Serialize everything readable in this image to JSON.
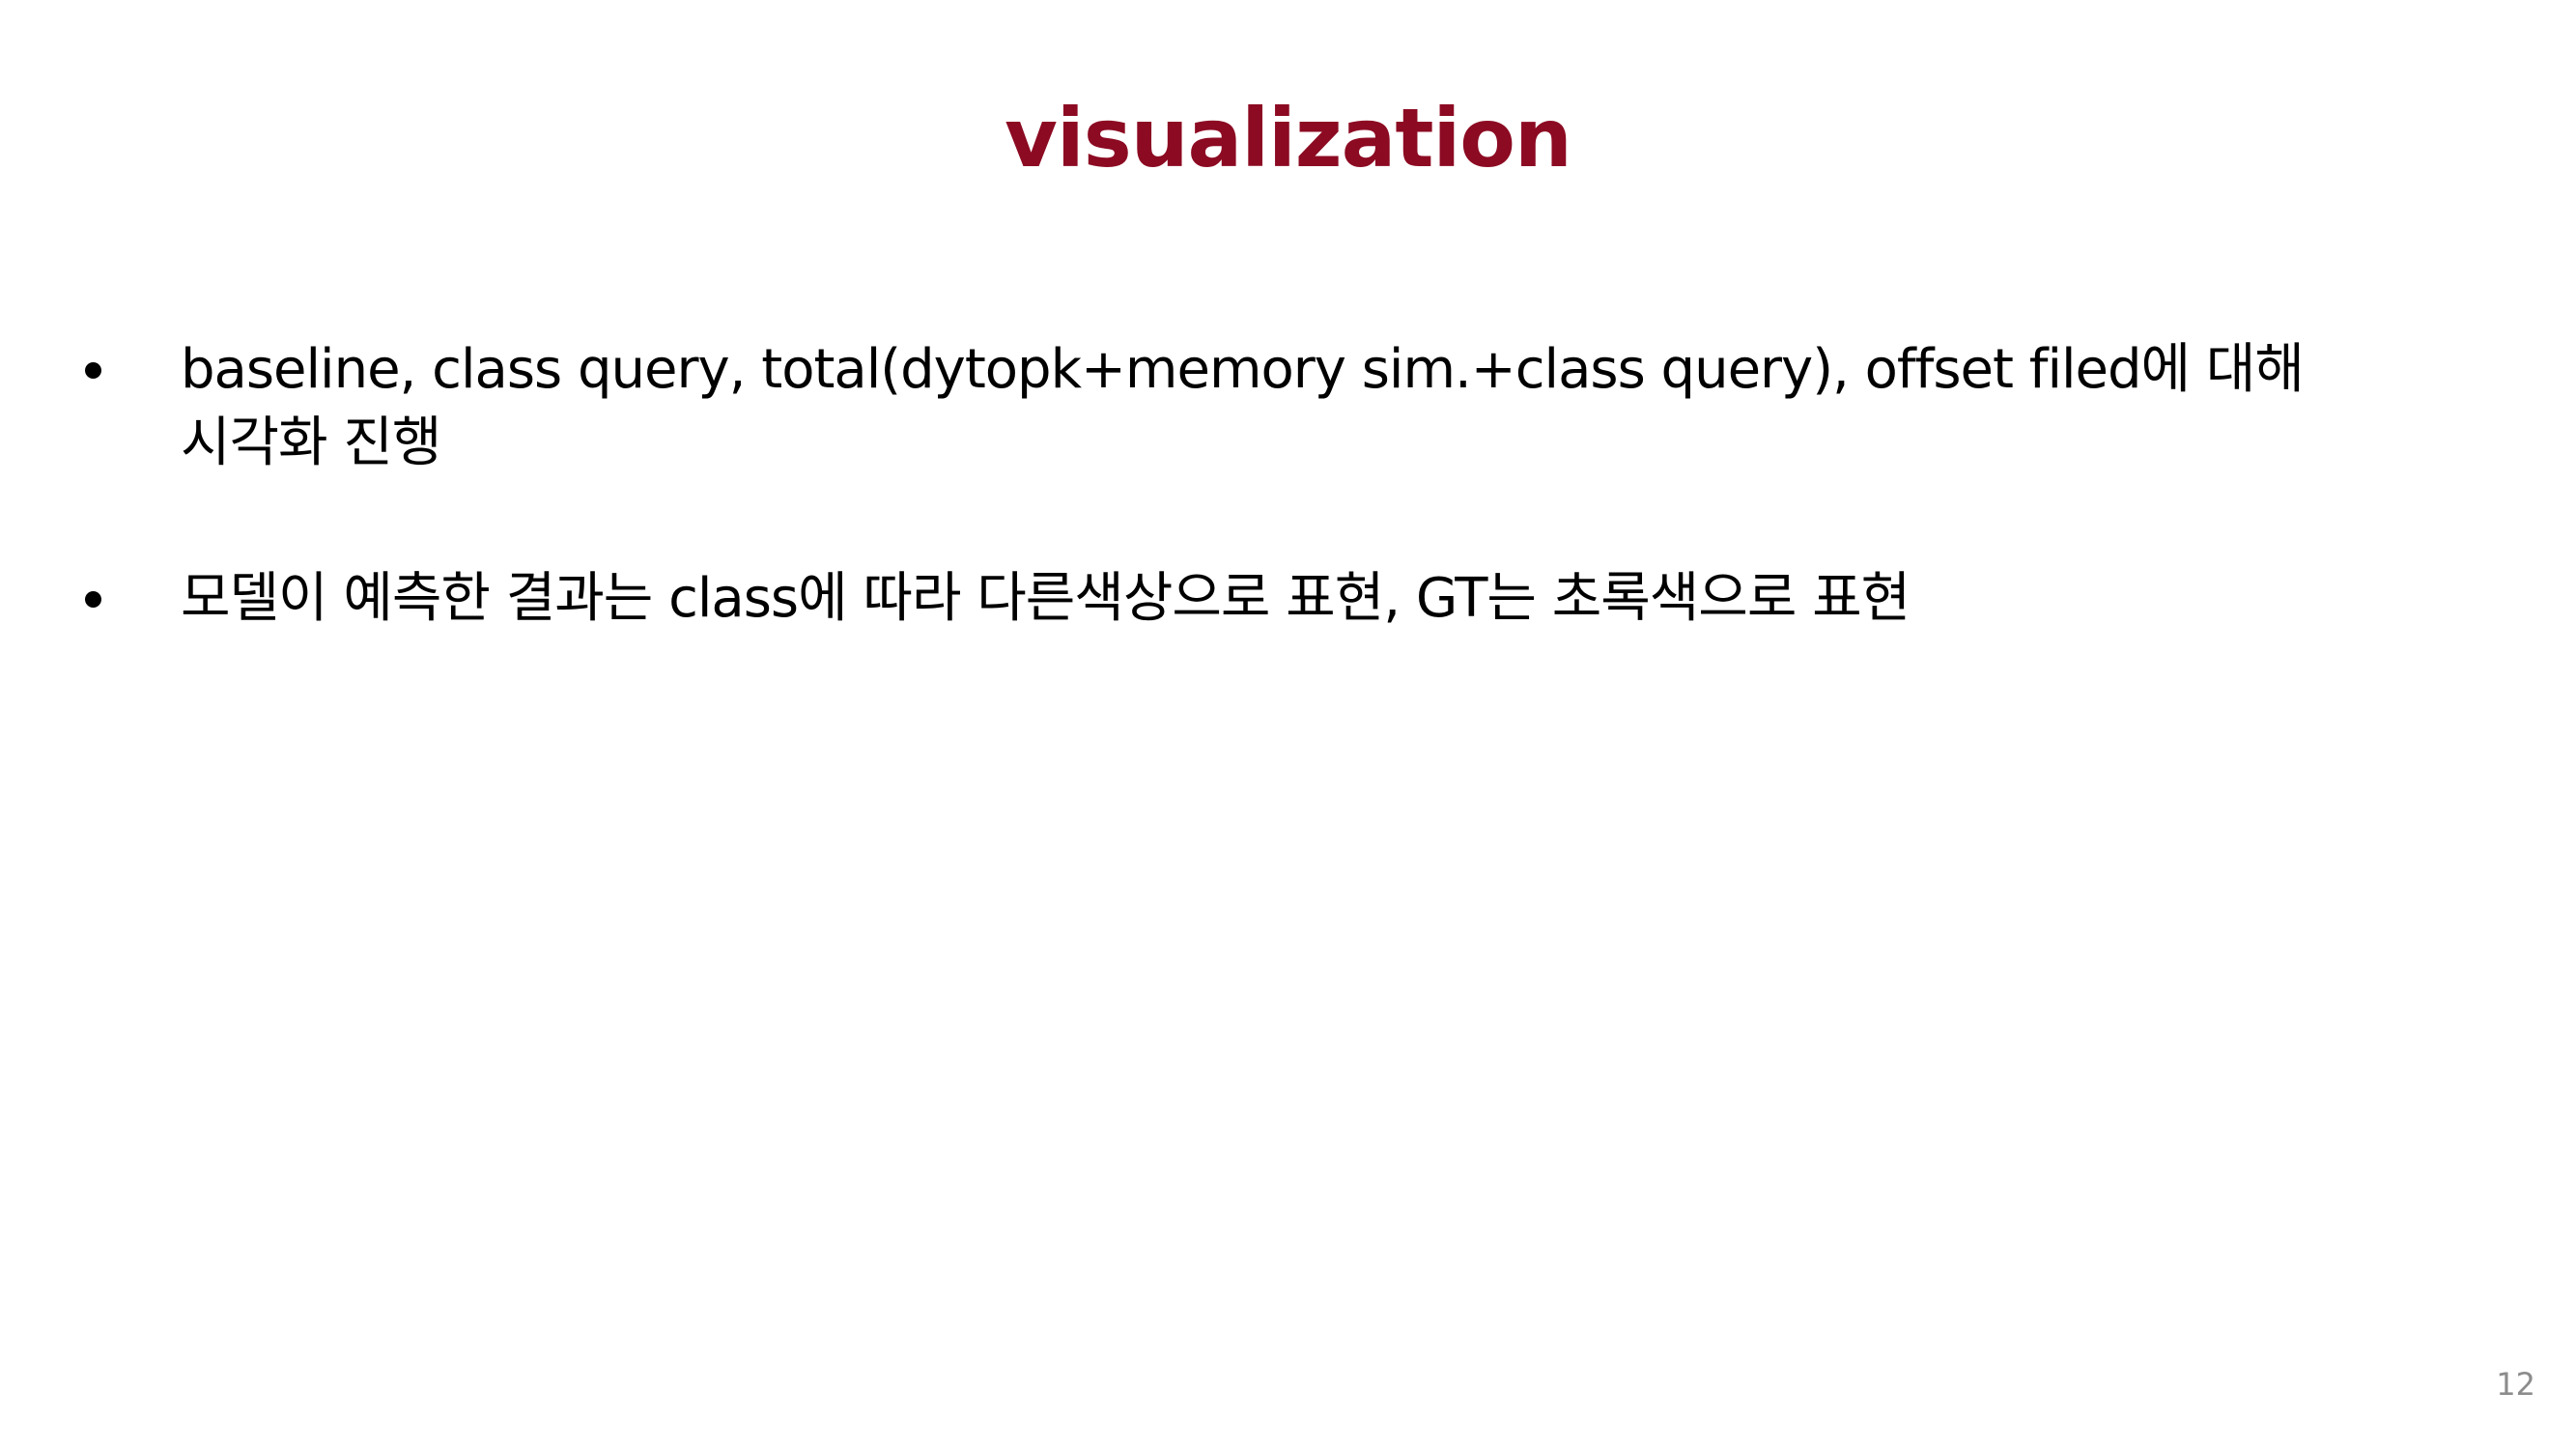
{
  "slide": {
    "title": "visualization",
    "bullets": [
      {
        "lines": [
          "baseline, class query, total(dytopk+memory sim.+class query), offset filed에 대해",
          "시각화 진행"
        ]
      },
      {
        "lines": [
          "모델이 예측한 결과는 class에 따라 다른색상으로 표현, GT는 초록색으로 표현"
        ]
      }
    ],
    "page_number": "12"
  },
  "colors": {
    "title": "#8c0a22",
    "body_text": "#000000",
    "page_number": "#8c8c8c",
    "background": "#ffffff"
  }
}
